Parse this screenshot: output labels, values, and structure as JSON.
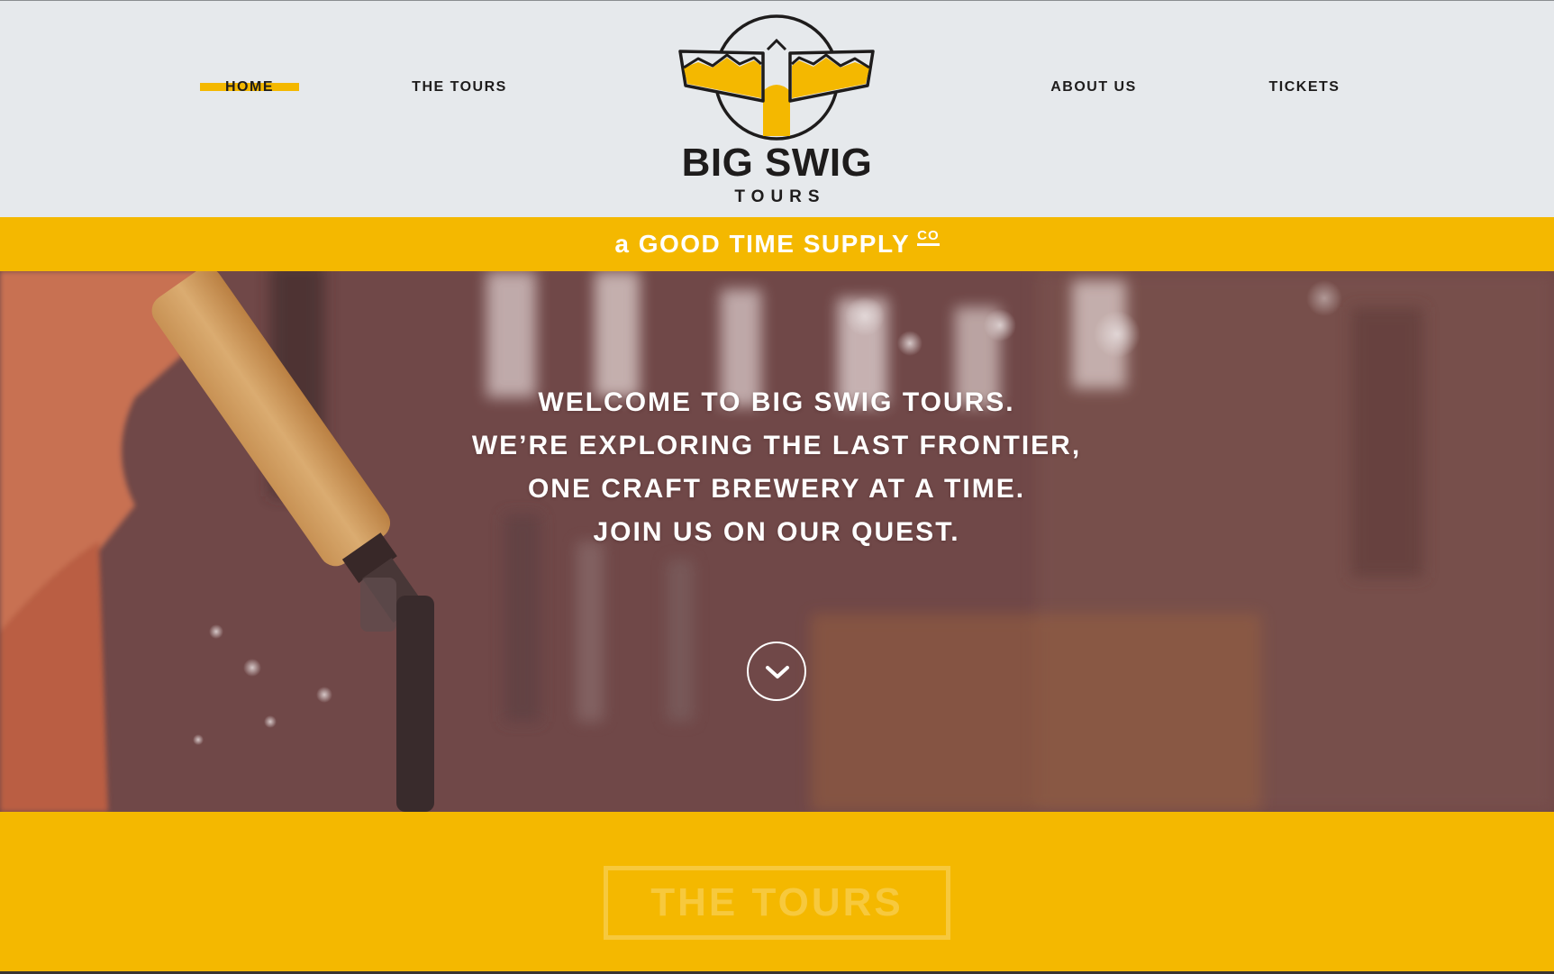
{
  "nav": {
    "items": [
      {
        "label": "HOME",
        "active": true
      },
      {
        "label": "THE TOURS",
        "active": false
      },
      {
        "label": "ABOUT US",
        "active": false
      },
      {
        "label": "TICKETS",
        "active": false
      }
    ]
  },
  "logo": {
    "name": "BIG SWIG",
    "subtitle": "TOURS"
  },
  "tagline": {
    "text": "a GOOD TIME SUPPLY",
    "suffix": "CO"
  },
  "hero": {
    "lines": [
      "WELCOME TO BIG SWIG TOURS.",
      "WE’RE EXPLORING THE LAST FRONTIER,",
      "ONE CRAFT BREWERY AT A TIME.",
      "JOIN US ON OUR QUEST."
    ],
    "scroll_icon": "chevron-down-icon"
  },
  "tours_section": {
    "button_label": "THE TOURS"
  },
  "colors": {
    "accent": "#f4b800",
    "header_bg": "#e6e9ec",
    "text_dark": "#1e1c1c",
    "hero_overlay": "#6e4848"
  }
}
